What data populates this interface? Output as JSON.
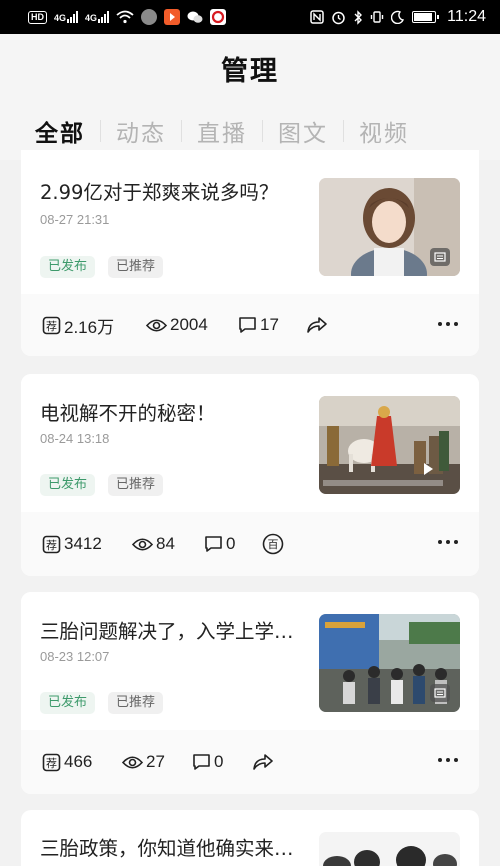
{
  "status_bar": {
    "time": "11:24",
    "net1": "4G",
    "net2": "4G",
    "hd": "HD"
  },
  "header": {
    "title": "管理"
  },
  "tabs": [
    {
      "label": "全部",
      "active": true
    },
    {
      "label": "动态",
      "active": false
    },
    {
      "label": "直播",
      "active": false
    },
    {
      "label": "图文",
      "active": false
    },
    {
      "label": "视频",
      "active": false
    }
  ],
  "cards": [
    {
      "title": "2.99亿对于郑爽来说多吗？",
      "time": "08-27 21:31",
      "status": "已发布",
      "tag": "已推荐",
      "recommend_count": "2.16万",
      "views": "2004",
      "comments": "17",
      "fourth_icon": "share-icon",
      "thumb_icon": "article-icon"
    },
    {
      "title": "电视解不开的秘密！",
      "time": "08-24 13:18",
      "status": "已发布",
      "tag": "已推荐",
      "recommend_count": "3412",
      "views": "84",
      "comments": "0",
      "fourth_icon": "bai-icon",
      "thumb_icon": "play-icon"
    },
    {
      "title": "三胎问题解决了，入学上学…",
      "time": "08-23 12:07",
      "status": "已发布",
      "tag": "已推荐",
      "recommend_count": "466",
      "views": "27",
      "comments": "0",
      "fourth_icon": "share-icon",
      "thumb_icon": "article-icon"
    },
    {
      "title": "三胎政策，你知道他确实来…"
    }
  ],
  "icons": {
    "recommend": "recommend-icon",
    "views": "eye-icon",
    "comments": "comment-icon",
    "more": "more-icon",
    "bai_glyph": "百"
  },
  "colors": {
    "published_text": "#3d9a6b",
    "published_bg": "#eef5f1",
    "tag_bg": "#f0f0f0"
  }
}
